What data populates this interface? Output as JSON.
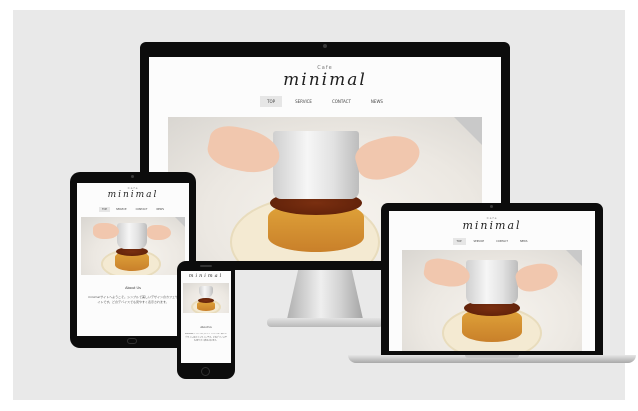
{
  "site": {
    "kicker": "Cafe",
    "name": "minimal"
  },
  "nav": {
    "items": [
      {
        "label": "TOP",
        "active": true
      },
      {
        "label": "SERVICE",
        "active": false
      },
      {
        "label": "CONTACT",
        "active": false
      },
      {
        "label": "NEWS",
        "active": false
      }
    ]
  },
  "content": {
    "section_heading": "About Us",
    "paragraph": "minimalサイトへようこそ。シンプルで美しいデザインのカフェサイトです。どのデバイスでも見やすく表示されます。"
  },
  "colors": {
    "stage": "#e9e9e9",
    "bezel": "#0c0c0c",
    "caramel": "#5a1e08",
    "custard": "#e0a43a"
  }
}
